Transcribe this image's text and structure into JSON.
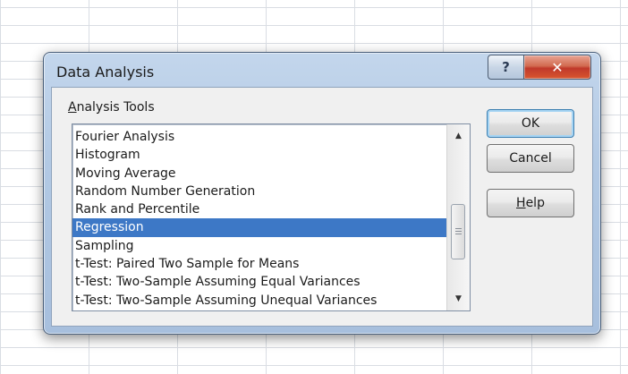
{
  "dialog": {
    "title": "Data Analysis",
    "help_caption": "?",
    "close_caption": "✕",
    "group_label_accel": "A",
    "group_label_rest": "nalysis Tools",
    "list_items": [
      "Fourier Analysis",
      "Histogram",
      "Moving Average",
      "Random Number Generation",
      "Rank and Percentile",
      "Regression",
      "Sampling",
      "t-Test: Paired Two Sample for Means",
      "t-Test: Two-Sample Assuming Equal Variances",
      "t-Test: Two-Sample Assuming Unequal Variances"
    ],
    "selected_item": "Regression",
    "buttons": {
      "ok_label": "OK",
      "cancel_label": "Cancel",
      "help_accel": "H",
      "help_rest": "elp"
    },
    "scroll_up_glyph": "▲",
    "scroll_down_glyph": "▼"
  }
}
